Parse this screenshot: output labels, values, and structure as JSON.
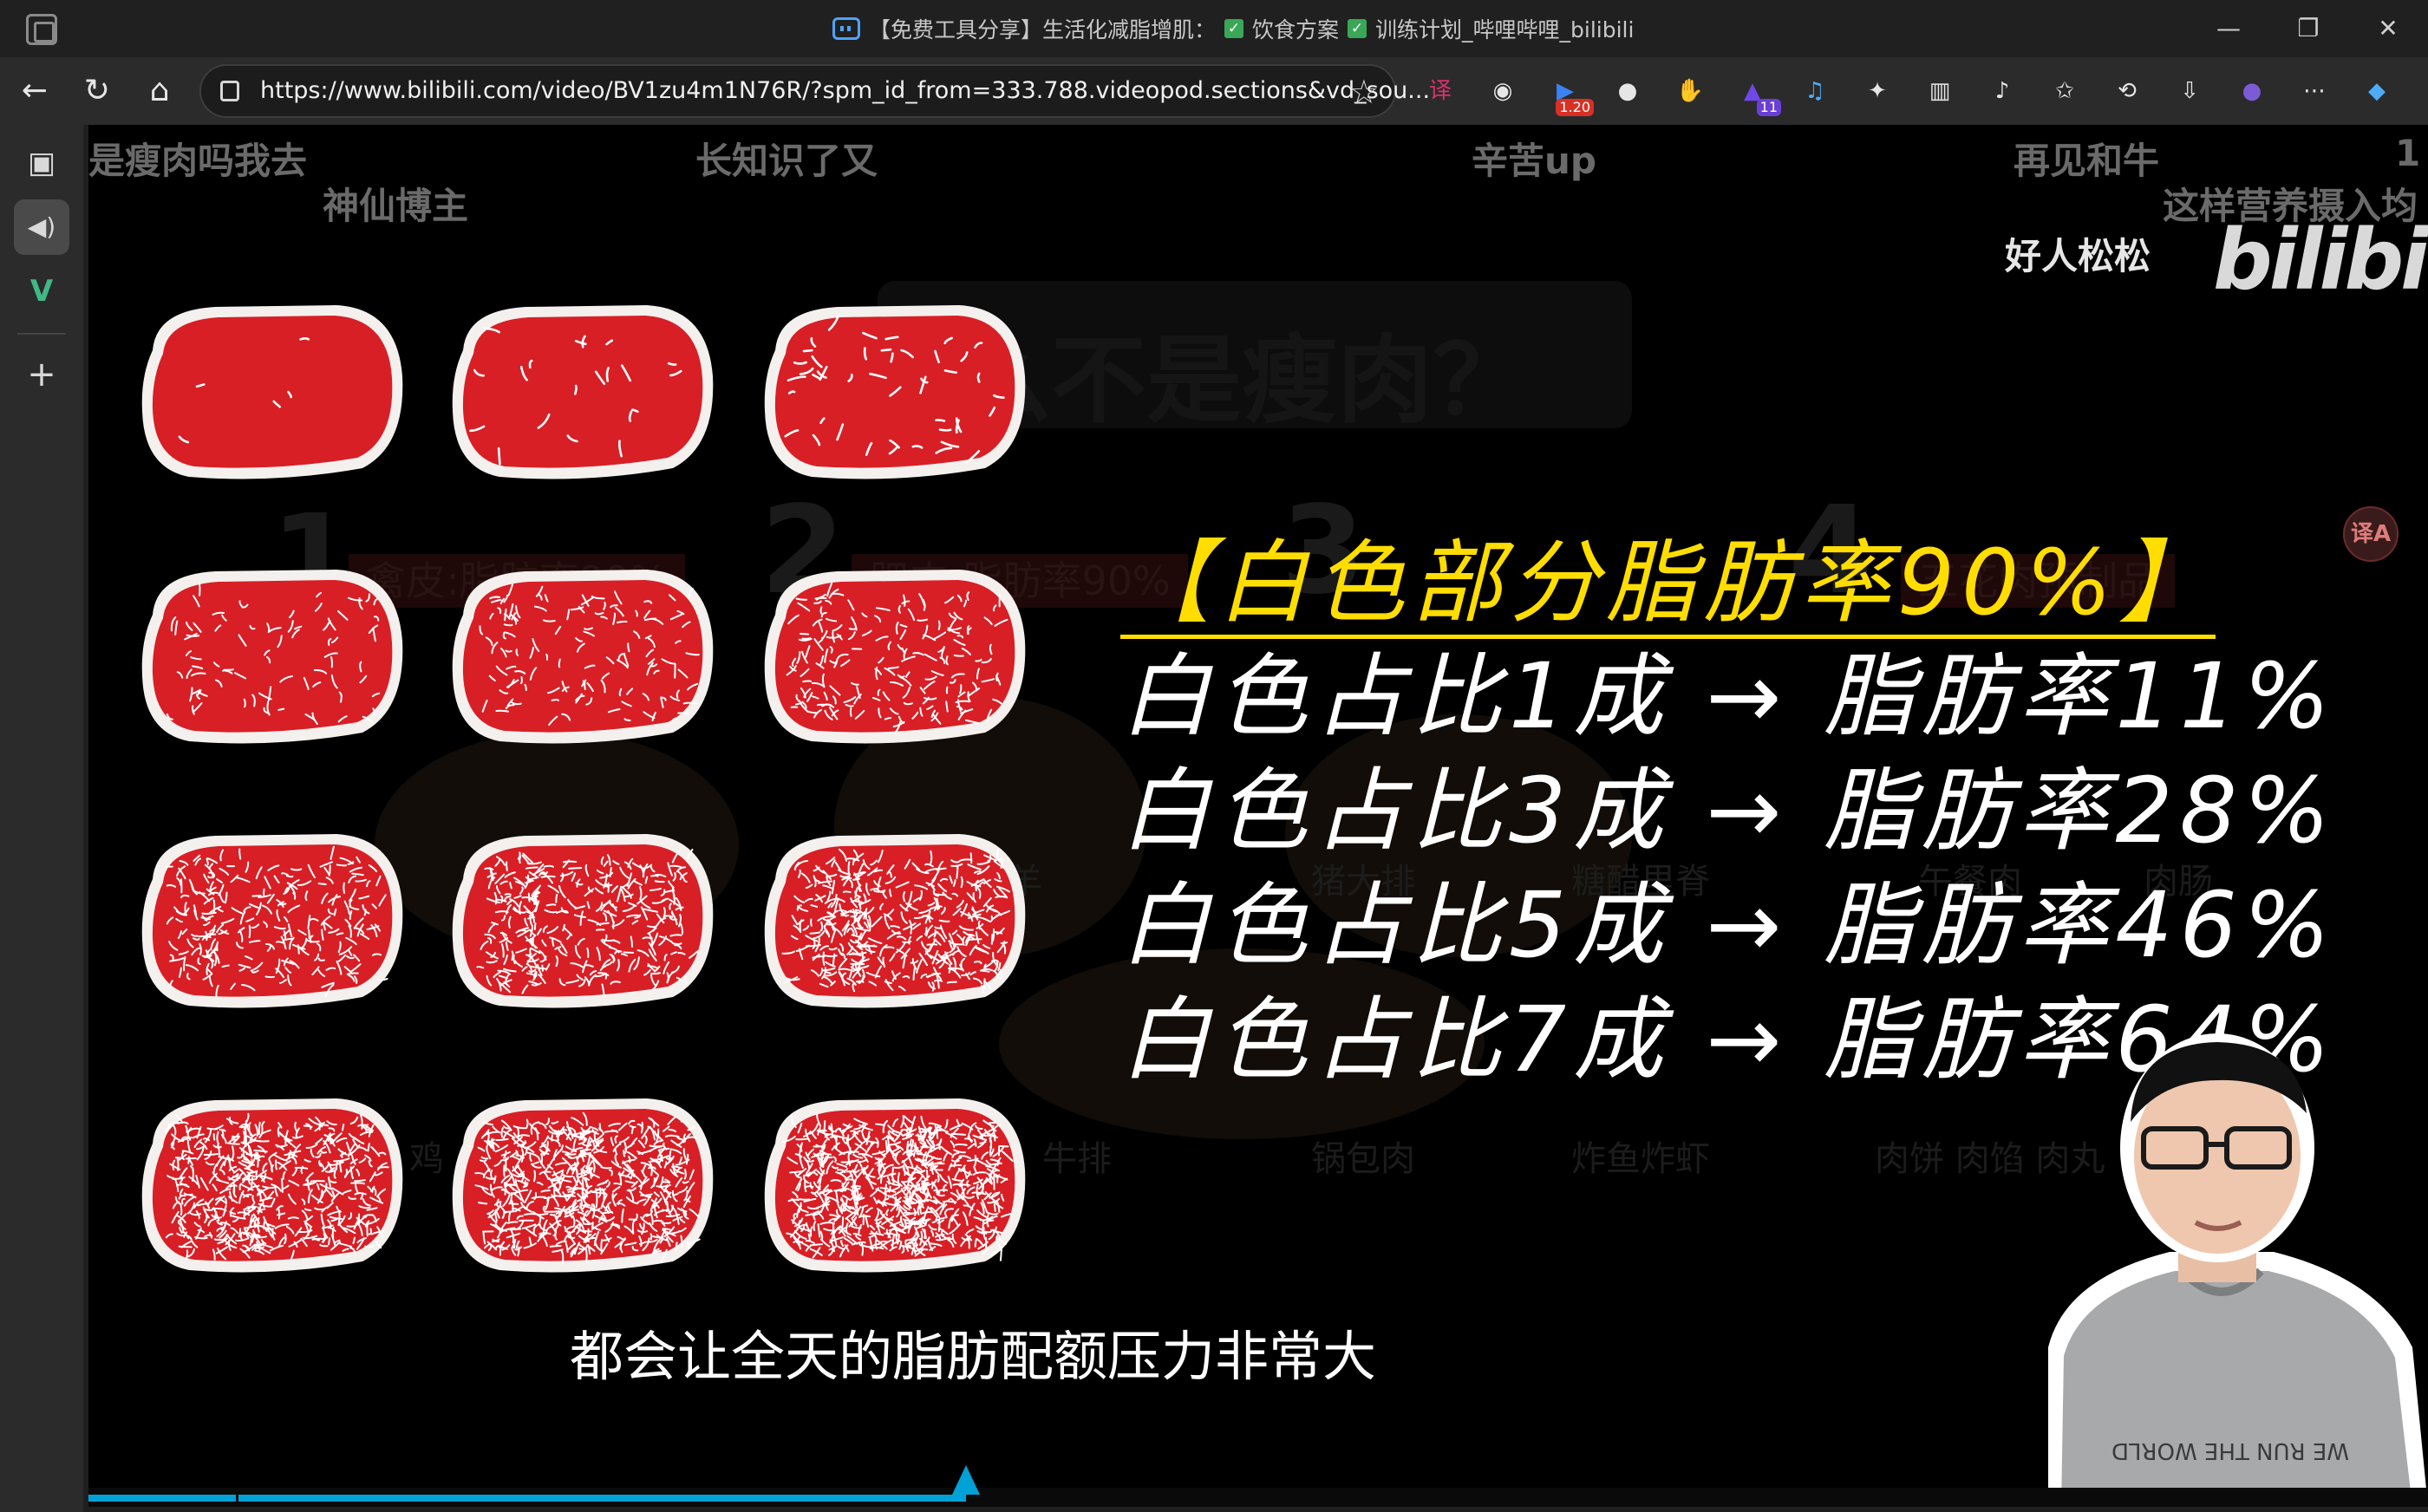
{
  "window": {
    "title_prefix": "【免费工具分享】生活化减脂增肌：",
    "title_tag1": "饮食方案",
    "title_tag2": "训练计划_哔哩哔哩_bilibili",
    "controls": {
      "minimize": "—",
      "restore": "❐",
      "close": "✕"
    }
  },
  "nav": {
    "url": "https://www.bilibili.com/video/BV1zu4m1N76R/?spm_id_from=333.788.videopod.sections&vd_sou...",
    "back": "←",
    "reload": "↻",
    "home": "⌂",
    "star": "☆",
    "extensions": [
      {
        "icon": "translate-icon",
        "glyph": "译",
        "color": "#d6336c"
      },
      {
        "icon": "glasses-icon",
        "glyph": "◉",
        "color": "#e6e6e6"
      },
      {
        "icon": "speed-icon",
        "glyph": "▶",
        "color": "#3b82f6",
        "badge": "1.20"
      },
      {
        "icon": "spy-icon",
        "glyph": "●",
        "color": "#e6e6e6"
      },
      {
        "icon": "stop-hand-icon",
        "glyph": "✋",
        "color": "#e03131"
      },
      {
        "icon": "hat-icon",
        "glyph": "▲",
        "color": "#7048e8",
        "badge": "11"
      },
      {
        "icon": "music-icon",
        "glyph": "♫",
        "color": "#4dabf7"
      },
      {
        "icon": "puzzle-icon",
        "glyph": "✦",
        "color": "#e6e6e6"
      },
      {
        "icon": "split-screen-icon",
        "glyph": "▥",
        "color": "#e6e6e6"
      },
      {
        "icon": "read-aloud-icon",
        "glyph": "♪",
        "color": "#e6e6e6"
      },
      {
        "icon": "favorites-icon",
        "glyph": "✩",
        "color": "#e6e6e6"
      },
      {
        "icon": "history-icon",
        "glyph": "⟲",
        "color": "#e6e6e6"
      },
      {
        "icon": "download-icon",
        "glyph": "⇩",
        "color": "#e6e6e6"
      },
      {
        "icon": "profile-avatar-icon",
        "glyph": "●",
        "color": "#7b5cd6"
      },
      {
        "icon": "more-icon",
        "glyph": "⋯",
        "color": "#e6e6e6"
      },
      {
        "icon": "copilot-icon",
        "glyph": "◆",
        "color": "#4dabf7"
      }
    ]
  },
  "sidebar": {
    "items": [
      {
        "name": "tabs-icon",
        "glyph": "▣"
      },
      {
        "name": "speaker-icon",
        "glyph": "🔊"
      },
      {
        "name": "vue-icon",
        "glyph": "V"
      },
      {
        "name": "add-icon",
        "glyph": "+"
      }
    ]
  },
  "video": {
    "danmaku": [
      "是瘦肉吗我去",
      "长知识了又",
      "辛苦up",
      "再见和牛",
      "1",
      "神仙博主",
      "这样营养摄入均",
      "好人松松"
    ],
    "logo": "bilibili",
    "bg": {
      "title": "么不是瘦肉？",
      "nums": [
        "1",
        "2",
        "3",
        "4"
      ],
      "labels": [
        "禽皮:脂肪率90%",
        "肥肉:脂肪率90%",
        "五花肉预制品"
      ],
      "dishes": [
        "羊",
        "猪大排",
        "糖醋里脊",
        "午餐肉",
        "肉肠",
        "鸡",
        "牛排",
        "锅包肉",
        "炸鱼炸虾",
        "肉饼 肉馅 肉丸"
      ]
    },
    "info": {
      "heading": "【白色部分脂肪率90%】",
      "rows": [
        "白色占比1成 → 脂肪率11%",
        "白色占比3成 → 脂肪率28%",
        "白色占比5成 → 脂肪率46%",
        "白色占比7成 → 脂肪率64%"
      ]
    },
    "subtitle": "都会让全天的脂肪配额压力非常大",
    "shirt_text": "WE RUN THE WORLD",
    "translate_badge": "译A",
    "meat_marbling_levels": [
      1,
      2,
      3,
      4,
      5,
      6,
      7,
      8,
      9,
      10,
      11,
      12
    ],
    "progress": 0.375,
    "colors": {
      "meat_red": "#d81f26",
      "meat_fat": "#ffffff",
      "accent_yellow": "#ffdd00",
      "progress_blue": "#00a1d6"
    }
  }
}
